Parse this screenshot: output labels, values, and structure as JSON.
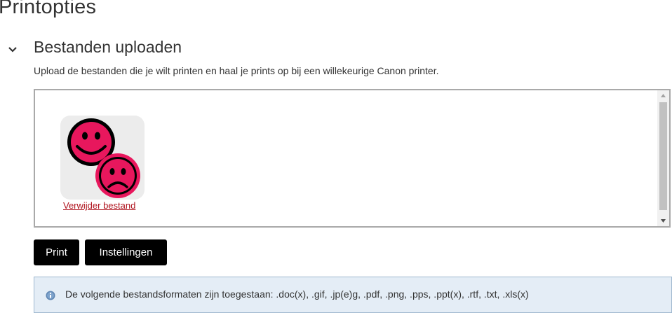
{
  "page": {
    "title": "Printopties"
  },
  "section": {
    "title": "Bestanden uploaden",
    "toggle_icon": "chevron-down-icon",
    "description": "Upload de bestanden die je wilt printen en haal je prints op bij een willekeurige Canon printer."
  },
  "upload": {
    "file_icon": "smiley-faces-icon",
    "remove_label": "Verwijder bestand"
  },
  "buttons": {
    "print_label": "Print",
    "settings_label": "Instellingen"
  },
  "info": {
    "icon": "info-icon",
    "text": "De volgende bestandsformaten zijn toegestaan: .doc(x), .gif, .jp(e)g, .pdf, .png, .pps, .ppt(x), .rtf, .txt, .xls(x)"
  },
  "colors": {
    "accent_pink": "#e8175d",
    "link_red": "#b0141f",
    "button_bg": "#000000",
    "info_bg": "#e4edf6",
    "info_border": "#9fb8cf"
  }
}
